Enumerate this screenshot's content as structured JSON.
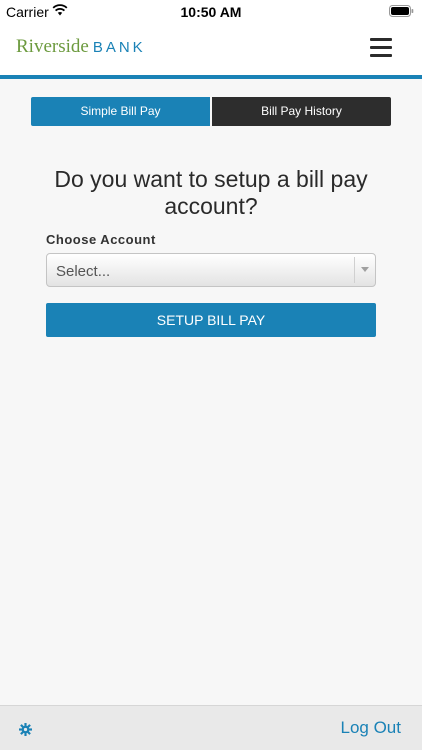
{
  "status_bar": {
    "carrier": "Carrier",
    "time": "10:50 AM",
    "icons": [
      "wifi-icon",
      "battery-icon"
    ]
  },
  "header": {
    "logo_word1": "Riverside",
    "logo_word2": "BANK",
    "menu_icon": "menu-icon"
  },
  "tabs": [
    {
      "label": "Simple Bill Pay",
      "active": true
    },
    {
      "label": "Bill Pay History",
      "active": false
    }
  ],
  "main": {
    "question": "Do you want to setup a bill pay account?",
    "field_label": "Choose Account",
    "select_value": "Select...",
    "button_label": "SETUP BILL PAY"
  },
  "footer": {
    "settings_icon": "gear-icon",
    "logout_label": "Log Out"
  },
  "colors": {
    "accent": "#1a82b6",
    "logo_green": "#6c9a3e",
    "dark_tab": "#2d2d2d",
    "background": "#f7f7f7"
  }
}
